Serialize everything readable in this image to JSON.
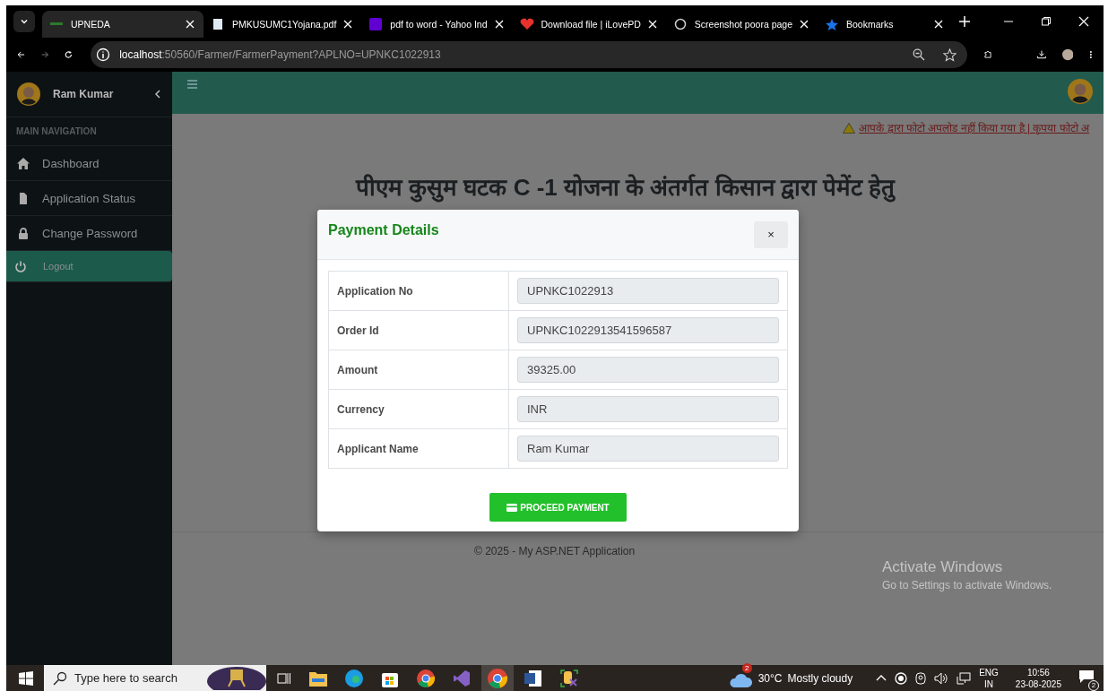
{
  "browser": {
    "tabs": [
      {
        "title": "UPNEDA",
        "selected": true
      },
      {
        "title": "PMKUSUMC1Yojana.pdf",
        "selected": false
      },
      {
        "title": "pdf to word - Yahoo Ind",
        "selected": false
      },
      {
        "title": "Download file | iLovePD",
        "selected": false
      },
      {
        "title": "Screenshot poora page",
        "selected": false
      },
      {
        "title": "Bookmarks",
        "selected": false
      }
    ],
    "address": {
      "host": "localhost",
      "path": ":50560/Farmer/FarmerPayment?APLNO=UPNKC1022913"
    }
  },
  "sidebar": {
    "user_name": "Ram Kumar",
    "section_label": "MAIN NAVIGATION",
    "items": [
      {
        "label": "Dashboard",
        "selected": false
      },
      {
        "label": "Application Status",
        "selected": false
      },
      {
        "label": "Change Password",
        "selected": false
      },
      {
        "label": "Logout",
        "selected": true
      }
    ]
  },
  "page": {
    "warning": "आपके द्वारा फोटो अपलोड नहीं किया गया है | कृपया फोटो अ",
    "heading": "पीएम कुसुम घटक C -1 योजना के अंतर्गत किसान द्वारा पेमेंट हेतु",
    "footer": "© 2025 - My ASP.NET Application"
  },
  "modal": {
    "title": "Payment Details",
    "close": "×",
    "rows": [
      {
        "label": "Application No",
        "value": "UPNKC1022913"
      },
      {
        "label": "Order Id",
        "value": "UPNKC1022913541596587"
      },
      {
        "label": "Amount",
        "value": "39325.00"
      },
      {
        "label": "Currency",
        "value": "INR"
      },
      {
        "label": "Applicant Name",
        "value": "Ram Kumar"
      }
    ],
    "button": "PROCEED PAYMENT"
  },
  "windows_notice": {
    "title": "Activate Windows",
    "subtitle": "Go to Settings to activate Windows."
  },
  "taskbar": {
    "search_placeholder": "Type here to search",
    "weather_badge": "2",
    "temperature": "30°C",
    "condition": "Mostly cloudy",
    "language": "ENG",
    "region": "IN",
    "time": "10:56",
    "date": "23-08-2025",
    "notifications": "2"
  }
}
